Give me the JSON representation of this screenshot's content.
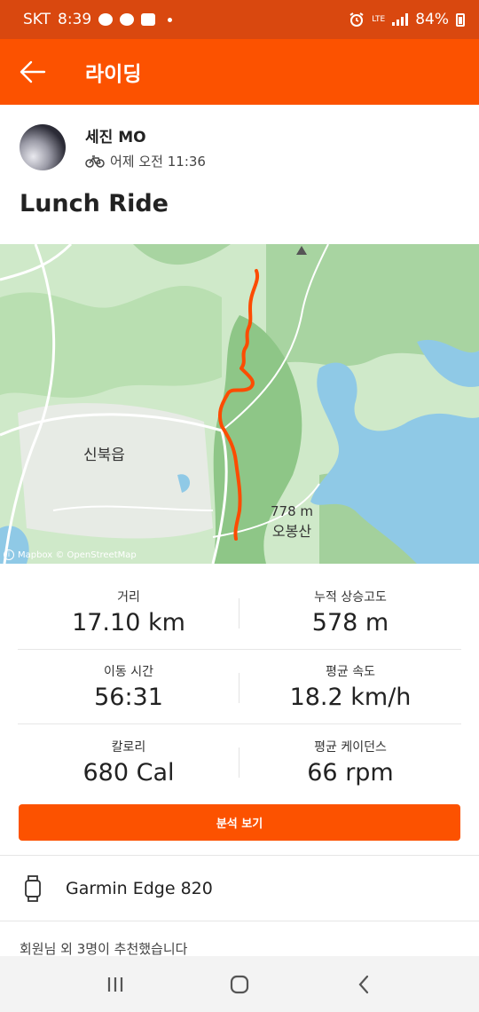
{
  "status_bar": {
    "carrier": "SKT",
    "time": "8:39",
    "network": "LTE",
    "battery": "84%"
  },
  "app_bar": {
    "title": "라이딩"
  },
  "athlete": {
    "name": "세진 MO",
    "timestamp": "어제 오전 11:36",
    "activity_icon": "bicycle-icon"
  },
  "activity": {
    "title": "Lunch Ride"
  },
  "map": {
    "peak_elevation": "778 m",
    "peak_name": "오봉산",
    "town_name": "신북읍",
    "attribution": "Mapbox © OpenStreetMap",
    "route_color": "#fc4c02",
    "water_color": "#8fc9e6"
  },
  "stats": [
    [
      {
        "label": "거리",
        "value": "17.10 km"
      },
      {
        "label": "누적 상승고도",
        "value": "578 m"
      }
    ],
    [
      {
        "label": "이동 시간",
        "value": "56:31"
      },
      {
        "label": "평균 속도",
        "value": "18.2 km/h"
      }
    ],
    [
      {
        "label": "칼로리",
        "value": "680 Cal"
      },
      {
        "label": "평균 케이던스",
        "value": "66 rpm"
      }
    ]
  ],
  "analysis_button": "분석 보기",
  "device": {
    "name": "Garmin Edge 820",
    "icon": "watch-icon"
  },
  "kudos": "회원님 외 3명이 추천했습니다",
  "colors": {
    "brand": "#fc5200",
    "status_bar": "#d9480f"
  }
}
